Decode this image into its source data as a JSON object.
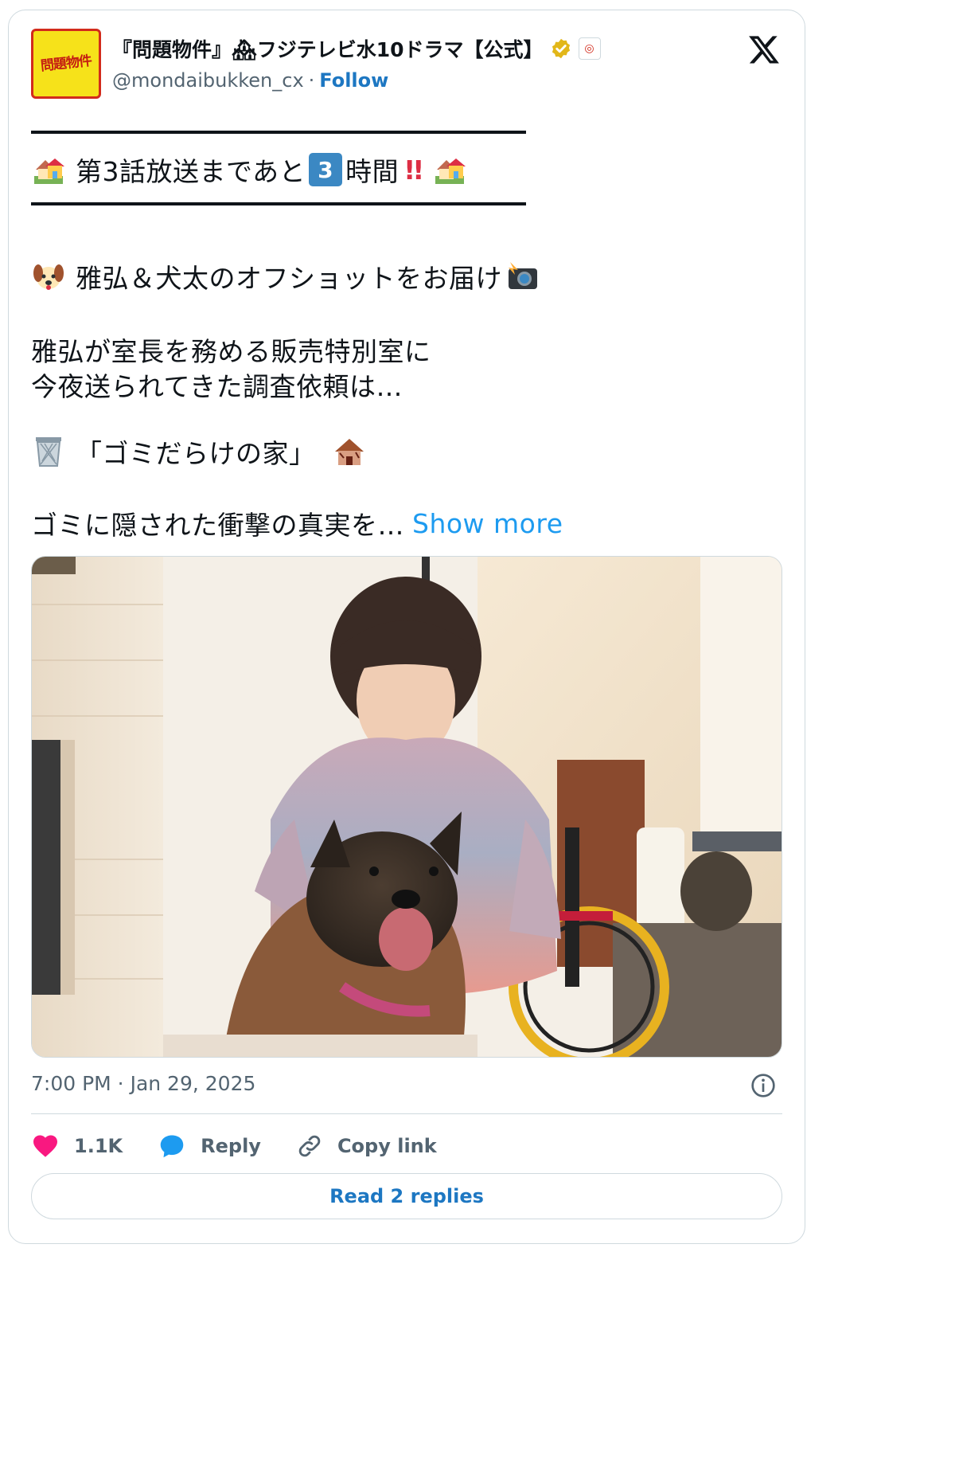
{
  "header": {
    "avatar_text": "問題物件",
    "display_name": "『問題物件』🏘フジテレビ水10ドラマ【公式】",
    "handle": "@mondaibukken_cx",
    "separator": "·",
    "follow_label": "Follow"
  },
  "tweet": {
    "line1_text": "第3話放送まであと",
    "line1_keycap": "3",
    "line1_after": "時間",
    "line1_bang": "!!",
    "line2": "雅弘＆犬太のオフショットをお届け",
    "line3": "雅弘が室長を務める販売特別室に",
    "line4": "今夜送られてきた調査依頼は…",
    "line5": "「ゴミだらけの家」",
    "line6": "ゴミに隠された衝撃の真実を…",
    "show_more": "Show more"
  },
  "footer": {
    "timestamp": "7:00 PM · Jan 29, 2025",
    "likes": "1.1K",
    "reply_label": "Reply",
    "copy_link_label": "Copy link",
    "read_replies_label": "Read 2 replies"
  },
  "colors": {
    "link_blue": "#1d9bf0",
    "follow_blue": "#1d77c2",
    "like_pink": "#f91880",
    "reply_blue": "#1d9bf0",
    "keycap_blue": "#3b88c3",
    "muted": "#536471"
  },
  "icons": [
    "x-logo-icon",
    "verified-badge-icon",
    "affiliate-badge-icon",
    "house-icon",
    "dog-face-icon",
    "camera-flash-icon",
    "wastebasket-icon",
    "derelict-house-icon",
    "info-icon",
    "heart-icon",
    "reply-bubble-icon",
    "link-icon"
  ]
}
